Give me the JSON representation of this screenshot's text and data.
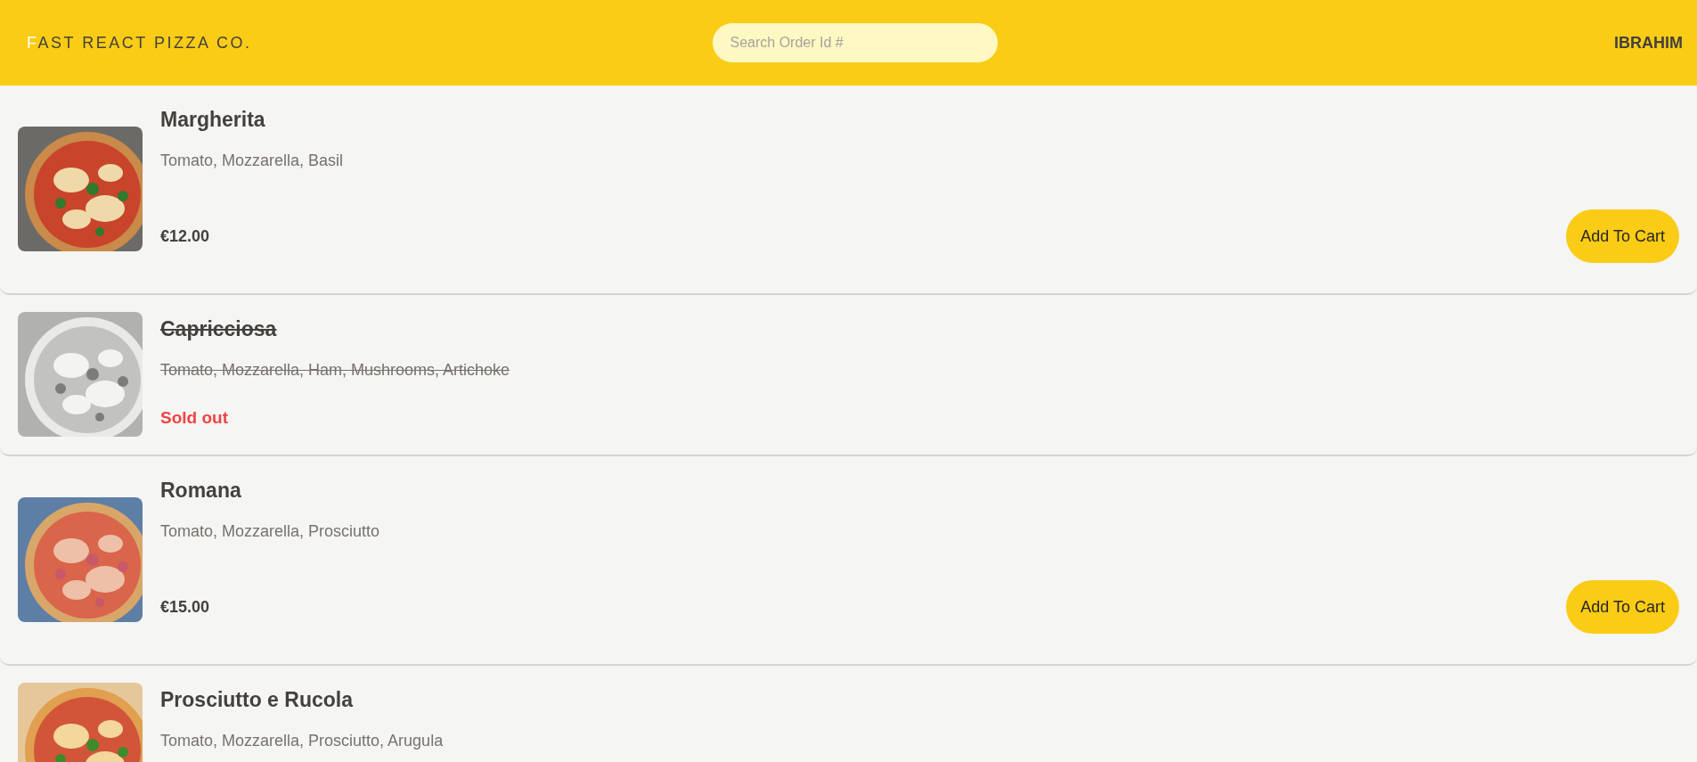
{
  "header": {
    "logo": "FAST REACT PIZZA CO.",
    "search": {
      "placeholder": "Search Order Id #"
    },
    "user": "IBRAHIM"
  },
  "menu": [
    {
      "name": "Margherita",
      "ingredients": "Tomato, Mozzarella, Basil",
      "sold_out": false,
      "price": "€12.00",
      "button": "Add To Cart"
    },
    {
      "name": "Capricciosa",
      "ingredients": "Tomato, Mozzarella, Ham, Mushrooms, Artichoke",
      "sold_out": true,
      "status": "Sold out"
    },
    {
      "name": "Romana",
      "ingredients": "Tomato, Mozzarella, Prosciutto",
      "sold_out": false,
      "price": "€15.00",
      "button": "Add To Cart"
    },
    {
      "name": "Prosciutto e Rucola",
      "ingredients": "Tomato, Mozzarella, Prosciutto, Arugula",
      "sold_out": false
    }
  ]
}
